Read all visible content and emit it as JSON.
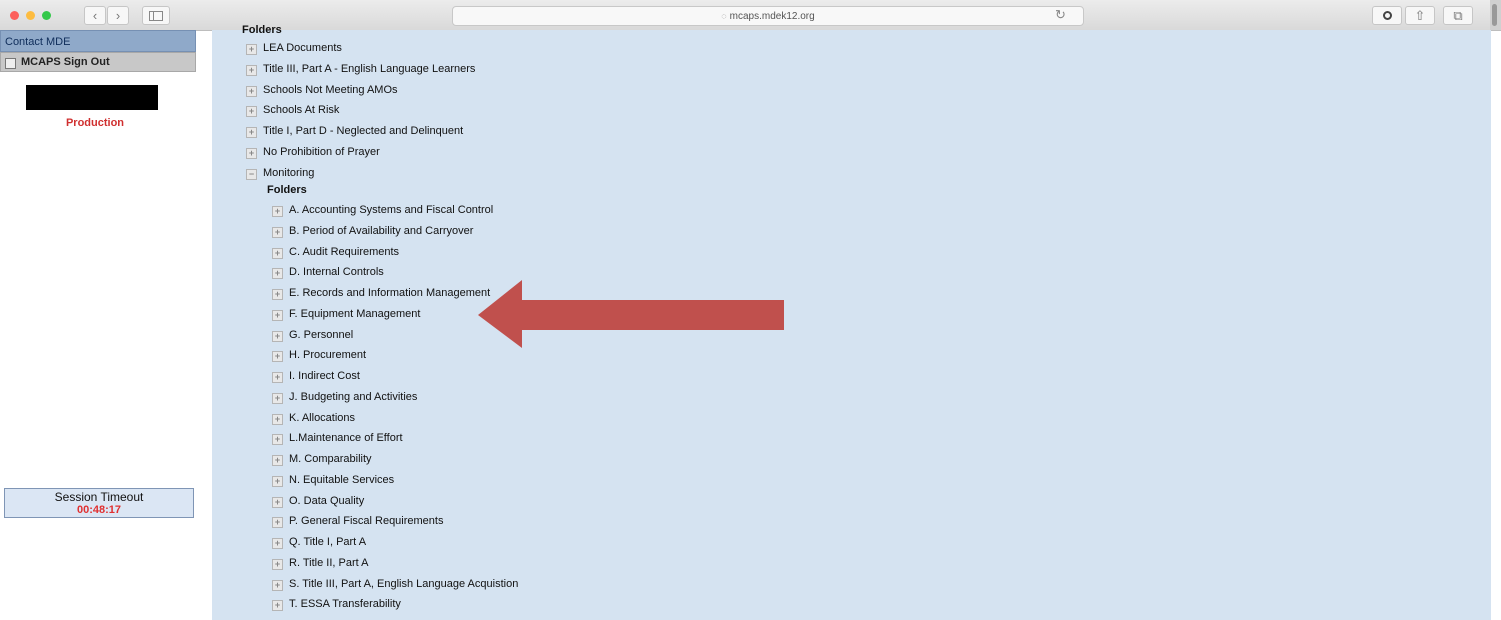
{
  "browser": {
    "url": "mcaps.mdek12.org",
    "lock_icon": "lock-icon",
    "back_glyph": "‹",
    "forward_glyph": "›",
    "reload_glyph": "↻",
    "share_glyph": "⇧",
    "tabs_glyph": "⧉",
    "colors": {
      "close": "#fc605c",
      "minimize": "#fdbc40",
      "zoom": "#34c84a"
    }
  },
  "sidebar": {
    "contact_label": "Contact MDE",
    "signout_label": "MCAPS Sign Out",
    "environment_label": "Production",
    "session": {
      "label": "Session Timeout",
      "value": "00:48:17"
    }
  },
  "tree": {
    "top_heading": "Folders",
    "top_items": [
      {
        "label": "LEA Documents",
        "state": "collapsed"
      },
      {
        "label": "Title III, Part A - English Language Learners",
        "state": "collapsed"
      },
      {
        "label": "Schools Not Meeting AMOs",
        "state": "collapsed"
      },
      {
        "label": "Schools At Risk",
        "state": "collapsed"
      },
      {
        "label": "Title I, Part D - Neglected and Delinquent",
        "state": "collapsed"
      },
      {
        "label": "No Prohibition of Prayer",
        "state": "collapsed"
      },
      {
        "label": "Monitoring",
        "state": "expanded"
      }
    ],
    "sub_heading": "Folders",
    "sub_items": [
      {
        "label": "A. Accounting Systems and Fiscal Control"
      },
      {
        "label": "B. Period of Availability and Carryover"
      },
      {
        "label": "C. Audit Requirements"
      },
      {
        "label": "D. Internal Controls"
      },
      {
        "label": "E. Records and Information Management"
      },
      {
        "label": "F. Equipment Management",
        "highlighted": true
      },
      {
        "label": "G. Personnel"
      },
      {
        "label": "H. Procurement"
      },
      {
        "label": "I. Indirect Cost"
      },
      {
        "label": "J. Budgeting and Activities"
      },
      {
        "label": "K. Allocations"
      },
      {
        "label": "L.Maintenance of Effort"
      },
      {
        "label": "M. Comparability"
      },
      {
        "label": "N. Equitable Services"
      },
      {
        "label": "O. Data Quality"
      },
      {
        "label": "P. General Fiscal Requirements"
      },
      {
        "label": "Q. Title I, Part A"
      },
      {
        "label": "R. Title II, Part A"
      },
      {
        "label": "S. Title III, Part A, English Language Acquistion"
      },
      {
        "label": "T. ESSA Transferability"
      }
    ],
    "expand_glyph": "+",
    "collapse_glyph": "−"
  },
  "annotation": {
    "arrow_color": "#c0504d",
    "points_to": "F. Equipment Management"
  }
}
